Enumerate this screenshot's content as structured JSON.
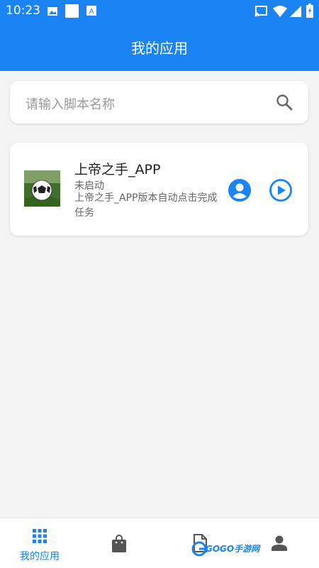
{
  "status_bar": {
    "time": "10:23",
    "icons": [
      "image-icon",
      "white-square-icon",
      "a-icon",
      "cast-icon",
      "wifi-icon",
      "signal-icon",
      "battery-icon"
    ]
  },
  "app_bar": {
    "title": "我的应用"
  },
  "search": {
    "placeholder": "请输入脚本名称",
    "icon": "search-icon"
  },
  "apps": [
    {
      "name": "上帝之手_APP",
      "status": "未启动",
      "description": "上帝之手_APP版本自动点击完成任务",
      "thumbnail": "soccer-ball-image"
    }
  ],
  "bottom_nav": {
    "items": [
      {
        "label": "我的应用",
        "icon": "grid-icon",
        "active": true
      },
      {
        "label": "",
        "icon": "shopping-bag-icon",
        "active": false
      },
      {
        "label": "",
        "icon": "document-icon",
        "active": false
      },
      {
        "label": "",
        "icon": "person-icon",
        "active": false
      }
    ]
  },
  "watermark": {
    "text": "GOGO手游网"
  },
  "colors": {
    "primary": "#1a84f5",
    "background": "#f3f3f3",
    "icon_gray": "#555555"
  }
}
